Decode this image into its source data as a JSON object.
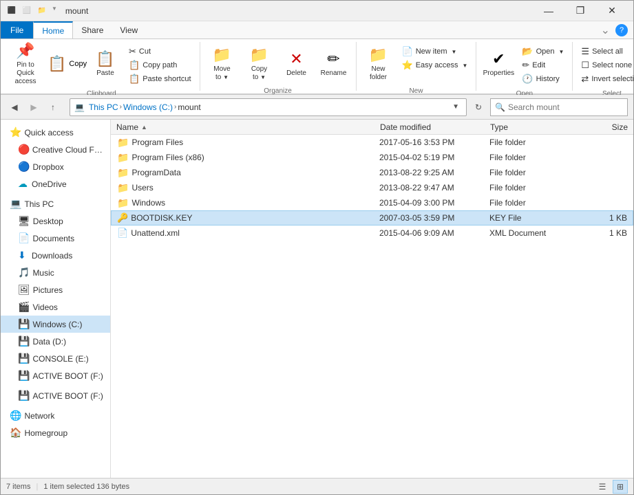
{
  "titlebar": {
    "title": "mount",
    "icons": [
      "⬛",
      "⬜",
      "📁"
    ],
    "controls": [
      "—",
      "❐",
      "✕"
    ]
  },
  "ribbon": {
    "tabs": [
      "File",
      "Home",
      "Share",
      "View"
    ],
    "active_tab": "Home",
    "groups": {
      "clipboard": {
        "label": "Clipboard",
        "pin_label": "Pin to Quick\naccess",
        "copy_label": "Copy",
        "paste_label": "Paste",
        "cut_label": "Cut",
        "copy_path_label": "Copy path",
        "paste_shortcut_label": "Paste shortcut"
      },
      "organize": {
        "label": "Organize",
        "move_to_label": "Move\nto",
        "copy_to_label": "Copy\nto",
        "delete_label": "Delete",
        "rename_label": "Rename"
      },
      "new": {
        "label": "New",
        "new_folder_label": "New\nfolder",
        "new_item_label": "New item",
        "easy_access_label": "Easy access"
      },
      "open": {
        "label": "Open",
        "open_label": "Open",
        "edit_label": "Edit",
        "history_label": "History",
        "properties_label": "Properties"
      },
      "select": {
        "label": "Select",
        "select_all_label": "Select all",
        "select_none_label": "Select none",
        "invert_label": "Invert selection"
      }
    }
  },
  "navbar": {
    "back_tooltip": "Back",
    "forward_tooltip": "Forward",
    "up_tooltip": "Up",
    "breadcrumbs": [
      "This PC",
      "Windows (C:)",
      "mount"
    ],
    "search_placeholder": "Search mount"
  },
  "sidebar": {
    "items": [
      {
        "id": "quick-access",
        "label": "Quick access",
        "icon": "⭐",
        "color": "#0072c6"
      },
      {
        "id": "creative-cloud",
        "label": "Creative Cloud Files",
        "icon": "🔴",
        "color": "#e00"
      },
      {
        "id": "dropbox",
        "label": "Dropbox",
        "icon": "🔵",
        "color": "#007ee5"
      },
      {
        "id": "onedrive",
        "label": "OneDrive",
        "icon": "☁",
        "color": "#0099bc"
      },
      {
        "id": "this-pc",
        "label": "This PC",
        "icon": "💻",
        "color": "#333"
      },
      {
        "id": "desktop",
        "label": "Desktop",
        "icon": "🖥",
        "indent": true
      },
      {
        "id": "documents",
        "label": "Documents",
        "icon": "📄",
        "indent": true
      },
      {
        "id": "downloads",
        "label": "Downloads",
        "icon": "⬇",
        "indent": true
      },
      {
        "id": "music",
        "label": "Music",
        "icon": "🎵",
        "indent": true
      },
      {
        "id": "pictures",
        "label": "Pictures",
        "icon": "🖼",
        "indent": true
      },
      {
        "id": "videos",
        "label": "Videos",
        "icon": "🎬",
        "indent": true
      },
      {
        "id": "windows-c",
        "label": "Windows (C:)",
        "icon": "💾",
        "indent": true,
        "selected": true
      },
      {
        "id": "data-d",
        "label": "Data (D:)",
        "icon": "💾",
        "indent": true
      },
      {
        "id": "console-e",
        "label": "CONSOLE (E:)",
        "icon": "💾",
        "indent": true
      },
      {
        "id": "active-boot-f",
        "label": "ACTIVE BOOT (F:)",
        "icon": "💾",
        "indent": true
      },
      {
        "id": "active-boot-f2",
        "label": "ACTIVE BOOT (F:)",
        "icon": "💾",
        "indent": true
      },
      {
        "id": "network",
        "label": "Network",
        "icon": "🌐"
      },
      {
        "id": "homegroup",
        "label": "Homegroup",
        "icon": "🏠"
      }
    ]
  },
  "file_list": {
    "columns": [
      "Name",
      "Date modified",
      "Type",
      "Size"
    ],
    "sort_column": "Name",
    "sort_asc": true,
    "files": [
      {
        "name": "Program Files",
        "date": "2017-05-16 3:53 PM",
        "type": "File folder",
        "size": "",
        "is_folder": true,
        "selected": false
      },
      {
        "name": "Program Files (x86)",
        "date": "2015-04-02 5:19 PM",
        "type": "File folder",
        "size": "",
        "is_folder": true,
        "selected": false
      },
      {
        "name": "ProgramData",
        "date": "2013-08-22 9:25 AM",
        "type": "File folder",
        "size": "",
        "is_folder": true,
        "selected": false
      },
      {
        "name": "Users",
        "date": "2013-08-22 9:47 AM",
        "type": "File folder",
        "size": "",
        "is_folder": true,
        "selected": false
      },
      {
        "name": "Windows",
        "date": "2015-04-09 3:00 PM",
        "type": "File folder",
        "size": "",
        "is_folder": true,
        "selected": false
      },
      {
        "name": "BOOTDISK.KEY",
        "date": "2007-03-05 3:59 PM",
        "type": "KEY File",
        "size": "1 KB",
        "is_folder": false,
        "selected": true
      },
      {
        "name": "Unattend.xml",
        "date": "2015-04-06 9:09 AM",
        "type": "XML Document",
        "size": "1 KB",
        "is_folder": false,
        "selected": false
      }
    ]
  },
  "statusbar": {
    "items_count": "7 items",
    "selected_info": "1 item selected  136 bytes"
  }
}
